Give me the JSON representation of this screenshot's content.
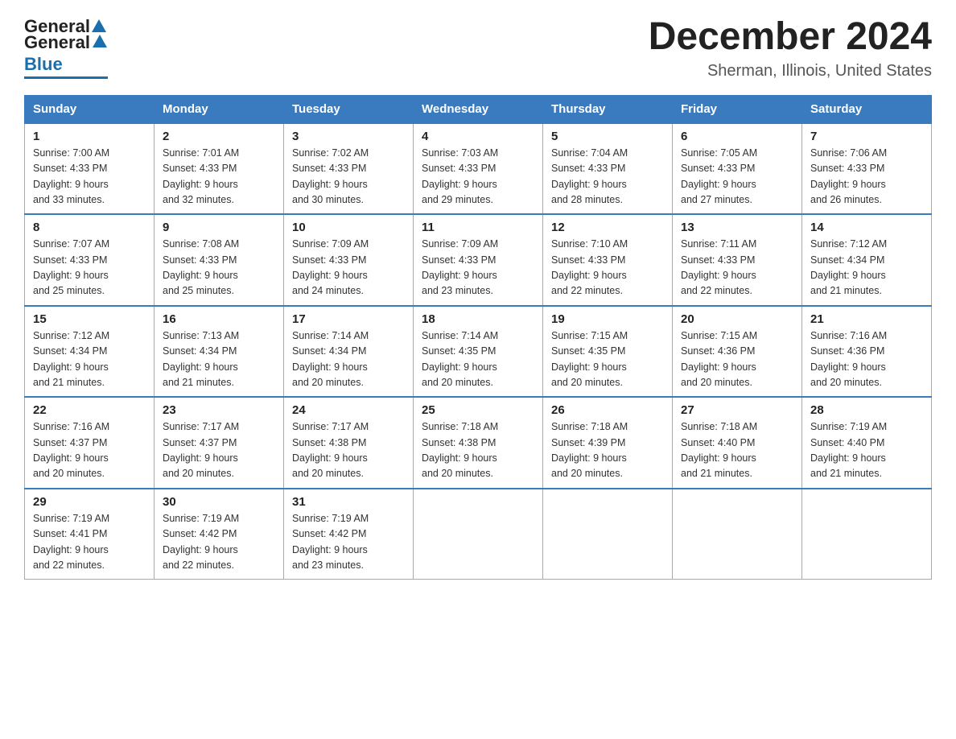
{
  "header": {
    "logo_general": "General",
    "logo_blue": "Blue",
    "title": "December 2024",
    "subtitle": "Sherman, Illinois, United States"
  },
  "days_of_week": [
    "Sunday",
    "Monday",
    "Tuesday",
    "Wednesday",
    "Thursday",
    "Friday",
    "Saturday"
  ],
  "weeks": [
    [
      {
        "day": "1",
        "sunrise": "7:00 AM",
        "sunset": "4:33 PM",
        "daylight": "9 hours and 33 minutes."
      },
      {
        "day": "2",
        "sunrise": "7:01 AM",
        "sunset": "4:33 PM",
        "daylight": "9 hours and 32 minutes."
      },
      {
        "day": "3",
        "sunrise": "7:02 AM",
        "sunset": "4:33 PM",
        "daylight": "9 hours and 30 minutes."
      },
      {
        "day": "4",
        "sunrise": "7:03 AM",
        "sunset": "4:33 PM",
        "daylight": "9 hours and 29 minutes."
      },
      {
        "day": "5",
        "sunrise": "7:04 AM",
        "sunset": "4:33 PM",
        "daylight": "9 hours and 28 minutes."
      },
      {
        "day": "6",
        "sunrise": "7:05 AM",
        "sunset": "4:33 PM",
        "daylight": "9 hours and 27 minutes."
      },
      {
        "day": "7",
        "sunrise": "7:06 AM",
        "sunset": "4:33 PM",
        "daylight": "9 hours and 26 minutes."
      }
    ],
    [
      {
        "day": "8",
        "sunrise": "7:07 AM",
        "sunset": "4:33 PM",
        "daylight": "9 hours and 25 minutes."
      },
      {
        "day": "9",
        "sunrise": "7:08 AM",
        "sunset": "4:33 PM",
        "daylight": "9 hours and 25 minutes."
      },
      {
        "day": "10",
        "sunrise": "7:09 AM",
        "sunset": "4:33 PM",
        "daylight": "9 hours and 24 minutes."
      },
      {
        "day": "11",
        "sunrise": "7:09 AM",
        "sunset": "4:33 PM",
        "daylight": "9 hours and 23 minutes."
      },
      {
        "day": "12",
        "sunrise": "7:10 AM",
        "sunset": "4:33 PM",
        "daylight": "9 hours and 22 minutes."
      },
      {
        "day": "13",
        "sunrise": "7:11 AM",
        "sunset": "4:33 PM",
        "daylight": "9 hours and 22 minutes."
      },
      {
        "day": "14",
        "sunrise": "7:12 AM",
        "sunset": "4:34 PM",
        "daylight": "9 hours and 21 minutes."
      }
    ],
    [
      {
        "day": "15",
        "sunrise": "7:12 AM",
        "sunset": "4:34 PM",
        "daylight": "9 hours and 21 minutes."
      },
      {
        "day": "16",
        "sunrise": "7:13 AM",
        "sunset": "4:34 PM",
        "daylight": "9 hours and 21 minutes."
      },
      {
        "day": "17",
        "sunrise": "7:14 AM",
        "sunset": "4:34 PM",
        "daylight": "9 hours and 20 minutes."
      },
      {
        "day": "18",
        "sunrise": "7:14 AM",
        "sunset": "4:35 PM",
        "daylight": "9 hours and 20 minutes."
      },
      {
        "day": "19",
        "sunrise": "7:15 AM",
        "sunset": "4:35 PM",
        "daylight": "9 hours and 20 minutes."
      },
      {
        "day": "20",
        "sunrise": "7:15 AM",
        "sunset": "4:36 PM",
        "daylight": "9 hours and 20 minutes."
      },
      {
        "day": "21",
        "sunrise": "7:16 AM",
        "sunset": "4:36 PM",
        "daylight": "9 hours and 20 minutes."
      }
    ],
    [
      {
        "day": "22",
        "sunrise": "7:16 AM",
        "sunset": "4:37 PM",
        "daylight": "9 hours and 20 minutes."
      },
      {
        "day": "23",
        "sunrise": "7:17 AM",
        "sunset": "4:37 PM",
        "daylight": "9 hours and 20 minutes."
      },
      {
        "day": "24",
        "sunrise": "7:17 AM",
        "sunset": "4:38 PM",
        "daylight": "9 hours and 20 minutes."
      },
      {
        "day": "25",
        "sunrise": "7:18 AM",
        "sunset": "4:38 PM",
        "daylight": "9 hours and 20 minutes."
      },
      {
        "day": "26",
        "sunrise": "7:18 AM",
        "sunset": "4:39 PM",
        "daylight": "9 hours and 20 minutes."
      },
      {
        "day": "27",
        "sunrise": "7:18 AM",
        "sunset": "4:40 PM",
        "daylight": "9 hours and 21 minutes."
      },
      {
        "day": "28",
        "sunrise": "7:19 AM",
        "sunset": "4:40 PM",
        "daylight": "9 hours and 21 minutes."
      }
    ],
    [
      {
        "day": "29",
        "sunrise": "7:19 AM",
        "sunset": "4:41 PM",
        "daylight": "9 hours and 22 minutes."
      },
      {
        "day": "30",
        "sunrise": "7:19 AM",
        "sunset": "4:42 PM",
        "daylight": "9 hours and 22 minutes."
      },
      {
        "day": "31",
        "sunrise": "7:19 AM",
        "sunset": "4:42 PM",
        "daylight": "9 hours and 23 minutes."
      },
      null,
      null,
      null,
      null
    ]
  ],
  "labels": {
    "sunrise": "Sunrise:",
    "sunset": "Sunset:",
    "daylight": "Daylight:"
  }
}
